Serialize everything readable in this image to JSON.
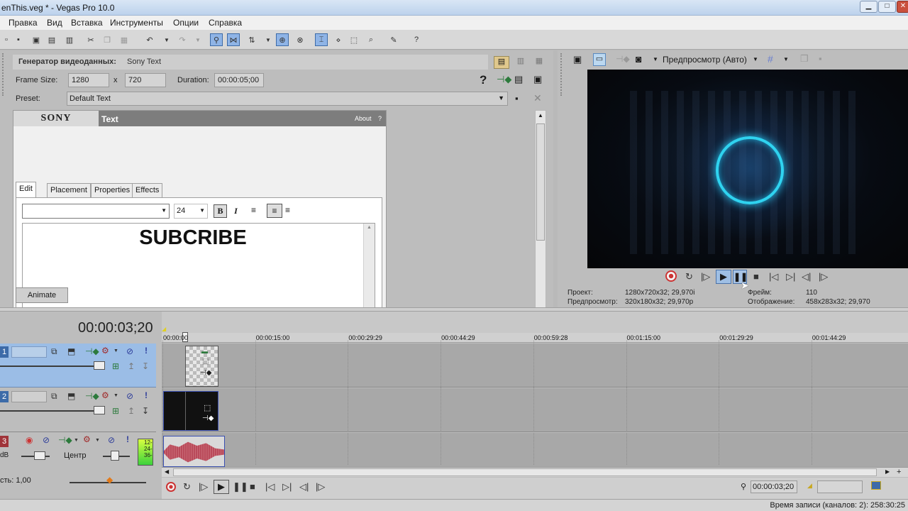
{
  "window": {
    "title": "enThis.veg * - Vegas Pro 10.0"
  },
  "menu": [
    "Правка",
    "Вид",
    "Вставка",
    "Инструменты",
    "Опции",
    "Справка"
  ],
  "generator": {
    "header_label": "Генератор видеоданных:",
    "header_value": "Sony Text",
    "frame_size_label": "Frame Size:",
    "width": "1280",
    "x": "x",
    "height": "720",
    "duration_label": "Duration:",
    "duration": "00:00:05;00",
    "preset_label": "Preset:",
    "preset": "Default Text",
    "help": "?"
  },
  "plugin": {
    "brand": "SONY",
    "title": "Text",
    "about": "About",
    "about_q": "?",
    "tabs": [
      "Edit",
      "Placement",
      "Properties",
      "Effects"
    ],
    "font_size": "24",
    "bold": "B",
    "italic": "I",
    "text_content": "SUBCRIBE"
  },
  "animate_button": "Animate",
  "preview": {
    "mode": "Предпросмотр (Авто)",
    "project_label": "Проект:",
    "project_value": "1280x720x32; 29,970i",
    "preview_label": "Предпросмотр:",
    "preview_value": "320x180x32; 29,970p",
    "frame_label": "Фрейм:",
    "frame_value": "110",
    "display_label": "Отображение:",
    "display_value": "458x283x32; 29,970"
  },
  "timeline": {
    "timecode": "00:00:03;20",
    "ruler": [
      "00:00:00",
      "00:00:15:00",
      "00:00:29:29",
      "00:00:44:29",
      "00:00:59:28",
      "00:01:15:00",
      "00:01:29:29",
      "00:01:44:29"
    ],
    "tracks": [
      {
        "num": "1"
      },
      {
        "num": "2"
      },
      {
        "num": "3",
        "db": "dB",
        "pan": "Центр",
        "meter": [
          "12-",
          "24-",
          "36-"
        ]
      }
    ],
    "rate_label": "сть: 1,00",
    "position": "00:00:03;20"
  },
  "status": {
    "record_time": "Время записи (каналов: 2): 258:30:25"
  },
  "colors": {
    "accent": "#3d6ba8",
    "track_selected": "#9bbde6",
    "audio_wave": "#b94a5a",
    "preview_ring": "#2fd3f0"
  }
}
